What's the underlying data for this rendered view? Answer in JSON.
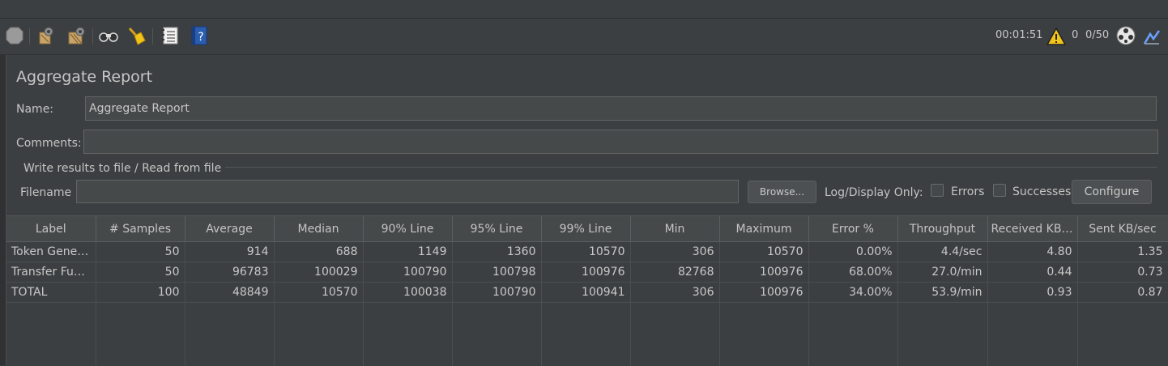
{
  "toolbar": {
    "icons": [
      "stop-icon",
      "clear-icon",
      "clear-all-icon",
      "search-icon",
      "reset-search-icon",
      "function-helper-icon",
      "help-icon"
    ],
    "timer": "00:01:51",
    "warning_count": "0",
    "threads": "0/50"
  },
  "panel": {
    "title": "Aggregate Report",
    "name_label": "Name:",
    "name_value": "Aggregate Report",
    "comments_label": "Comments:",
    "comments_value": "",
    "group_title": "Write results to file / Read from file",
    "filename_label": "Filename",
    "filename_value": "",
    "browse_label": "Browse...",
    "log_display_label": "Log/Display Only:",
    "errors_label": "Errors",
    "successes_label": "Successes",
    "configure_label": "Configure"
  },
  "table": {
    "columns": [
      "Label",
      "# Samples",
      "Average",
      "Median",
      "90% Line",
      "95% Line",
      "99% Line",
      "Min",
      "Maximum",
      "Error %",
      "Throughput",
      "Received KB/...",
      "Sent KB/sec"
    ],
    "rows": [
      [
        "Token Genera...",
        "50",
        "914",
        "688",
        "1149",
        "1360",
        "10570",
        "306",
        "10570",
        "0.00%",
        "4.4/sec",
        "4.80",
        "1.35"
      ],
      [
        "Transfer Fund...",
        "50",
        "96783",
        "100029",
        "100790",
        "100798",
        "100976",
        "82768",
        "100976",
        "68.00%",
        "27.0/min",
        "0.44",
        "0.73"
      ],
      [
        "TOTAL",
        "100",
        "48849",
        "10570",
        "100038",
        "100790",
        "100941",
        "306",
        "100976",
        "34.00%",
        "53.9/min",
        "0.93",
        "0.87"
      ]
    ]
  }
}
